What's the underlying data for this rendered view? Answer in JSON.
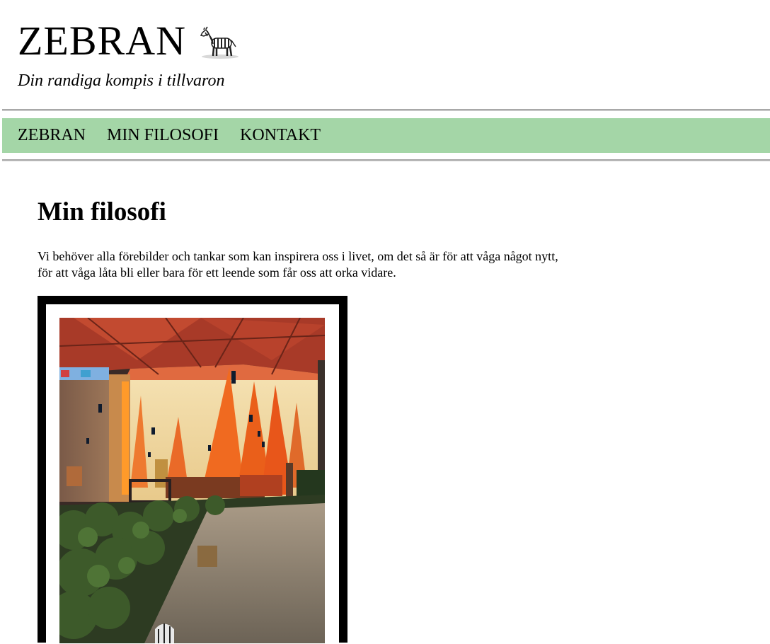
{
  "site": {
    "title": "ZEBRAN",
    "tagline": "Din randiga kompis i tillvaron"
  },
  "nav": {
    "items": [
      {
        "label": "ZEBRAN"
      },
      {
        "label": "MIN FILOSOFI"
      },
      {
        "label": "KONTAKT"
      }
    ]
  },
  "main": {
    "heading": "Min filosofi",
    "intro_line1": "Vi behöver alla förebilder och tankar som kan inspirera oss i livet, om det så är för att våga något nytt,",
    "intro_line2": "för att våga låta bli eller bara för ett leende som får oss att orka vidare."
  },
  "colors": {
    "nav_background": "#a4d6a7",
    "frame": "#000000"
  },
  "icons": {
    "logo": "zebra-icon"
  }
}
